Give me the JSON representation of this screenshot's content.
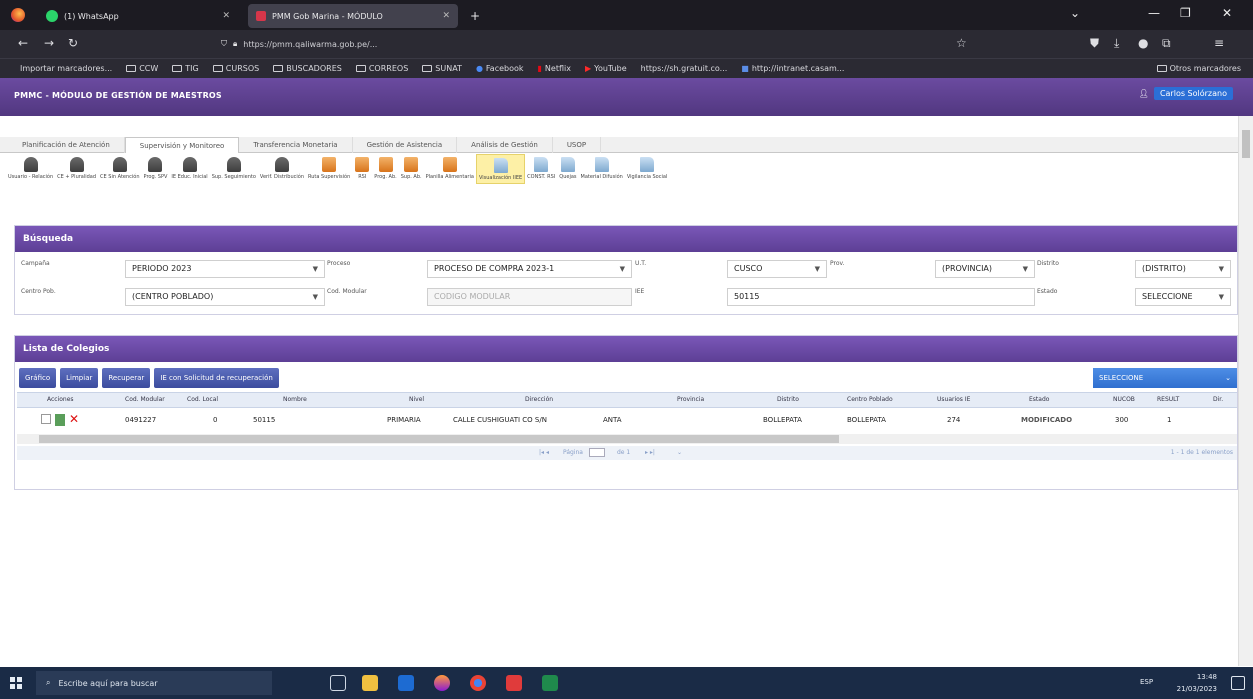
{
  "browser": {
    "tabs": [
      {
        "title": "(1) WhatsApp"
      },
      {
        "title": "PMM Gob Marina - MÓDULO"
      }
    ],
    "new_tab": "+",
    "url": "https://pmm.qaliwarma.gob.pe/...",
    "bookmarks": [
      "Importar marcadores...",
      "CCW",
      "TIG",
      "CURSOS",
      "BUSCADORES",
      "CORREOS",
      "SUNAT",
      "Facebook",
      "Netflix",
      "YouTube",
      "https://sh.gratuit.co...",
      "http://intranet.casam..."
    ],
    "other_bookmarks": "Otros marcadores"
  },
  "app": {
    "title": "PMMC - MÓDULO DE GESTIÓN DE MAESTROS",
    "user_label": "Carlos Solórzano"
  },
  "menu_tabs": [
    "Planificación de Atención",
    "Supervisión y Monitoreo",
    "Transferencia Monetaria",
    "Gestión de Asistencia",
    "Análisis de Gestión",
    "USOP"
  ],
  "menu_active": 1,
  "toolbar": [
    {
      "label": "Usuario - Relación",
      "icon": "person"
    },
    {
      "label": "CE + Pluralidad",
      "icon": "person"
    },
    {
      "label": "CE Sin Atención",
      "icon": "person"
    },
    {
      "label": "Prog. SPV",
      "icon": "person"
    },
    {
      "label": "IE Educ. Inicial",
      "icon": "person"
    },
    {
      "label": "Sup. Seguimiento",
      "icon": "person"
    },
    {
      "label": "Verif. Distribución",
      "icon": "person"
    },
    {
      "label": "Ruta Supervisión",
      "icon": "box"
    },
    {
      "label": "RSI",
      "icon": "box"
    },
    {
      "label": "Prog. Ab.",
      "icon": "box"
    },
    {
      "label": "Sup. Ab.",
      "icon": "box"
    },
    {
      "label": "Planilla Alimentaria",
      "icon": "box"
    },
    {
      "label": "Visualización IIEE",
      "icon": "doc"
    },
    {
      "label": "CONST. RSI",
      "icon": "doc"
    },
    {
      "label": "Quejas",
      "icon": "doc"
    },
    {
      "label": "Material Difusión",
      "icon": "doc"
    },
    {
      "label": "Vigilancia Social",
      "icon": "doc"
    }
  ],
  "toolbar_active": 12,
  "search_panel": {
    "title": "Búsqueda",
    "campana_label": "Campaña",
    "campana_value": "PERIODO 2023",
    "proceso_label": "Proceso",
    "proceso_value": "PROCESO DE COMPRA 2023-1",
    "ut_label": "U.T.",
    "ut_value": "CUSCO",
    "prov_label": "Prov.",
    "prov_value": "(PROVINCIA)",
    "distrito_label": "Distrito",
    "distrito_value": "(DISTRITO)",
    "centro_label": "Centro Pob.",
    "centro_value": "(CENTRO POBLADO)",
    "cod_label": "Cod. Modular",
    "cod_placeholder": "CODIGO MODULAR",
    "iiee_label": "IEE",
    "iiee_value": "50115",
    "estado_label": "Estado",
    "estado_value": "SELECCIONE"
  },
  "list_panel": {
    "title": "Lista de Colegios",
    "buttons": [
      "Gráfico",
      "Limpiar",
      "Recuperar",
      "IE con Solicitud de recuperación"
    ],
    "select_label": "SELECCIONE",
    "columns": [
      "Acciones",
      "Cod. Modular",
      "Cod. Local",
      "Nombre",
      "Nivel",
      "Dirección",
      "Provincia",
      "Distrito",
      "Centro Poblado",
      "Usuarios IE",
      "Estado",
      "NUCOB",
      "RESULT",
      "Dir."
    ],
    "rows": [
      {
        "cod_modular": "0491227",
        "cod_local": "0",
        "nombre": "50115",
        "nivel": "PRIMARIA",
        "direccion": "CALLE CUSHIGUATI CO S/N",
        "provincia": "ANTA",
        "distrito": "BOLLEPATA",
        "centro": "BOLLEPATA",
        "usuarios": "274",
        "estado": "MODIFICADO",
        "nucob": "300",
        "result": "1"
      }
    ],
    "pager_text": "Página",
    "pager_of": "de 1",
    "records": "1 - 1 de 1 elementos"
  },
  "taskbar": {
    "search_placeholder": "Escribe aquí para buscar",
    "time": "13:48",
    "date": "21/03/2023",
    "lang": "ESP"
  }
}
